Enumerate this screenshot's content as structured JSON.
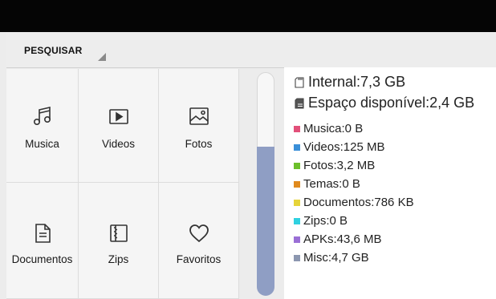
{
  "toolbar": {
    "search_label": "PESQUISAR"
  },
  "categories": [
    {
      "label": "Musica",
      "icon": "music-note-icon"
    },
    {
      "label": "Videos",
      "icon": "video-play-icon"
    },
    {
      "label": "Fotos",
      "icon": "image-icon"
    },
    {
      "label": "Documentos",
      "icon": "document-icon"
    },
    {
      "label": "Zips",
      "icon": "zip-icon"
    },
    {
      "label": "Favoritos",
      "icon": "heart-icon"
    }
  ],
  "storage": {
    "internal": "Internal:7,3 GB",
    "available": "Espaço disponível:2,4 GB",
    "breakdown": [
      {
        "label": "Musica:0 B",
        "color": "#e2507a"
      },
      {
        "label": "Videos:125 MB",
        "color": "#3a8fd8"
      },
      {
        "label": "Fotos:3,2 MB",
        "color": "#6cbf2b"
      },
      {
        "label": "Temas:0 B",
        "color": "#e08a1e"
      },
      {
        "label": "Documentos:786 KB",
        "color": "#e6d43a"
      },
      {
        "label": "Zips:0 B",
        "color": "#2fd1e0"
      },
      {
        "label": "APKs:43,6 MB",
        "color": "#9a6fd6"
      },
      {
        "label": "Misc:4,7 GB",
        "color": "#8c97b0"
      }
    ]
  },
  "scrollbar": {
    "position_fraction": 0.33
  }
}
